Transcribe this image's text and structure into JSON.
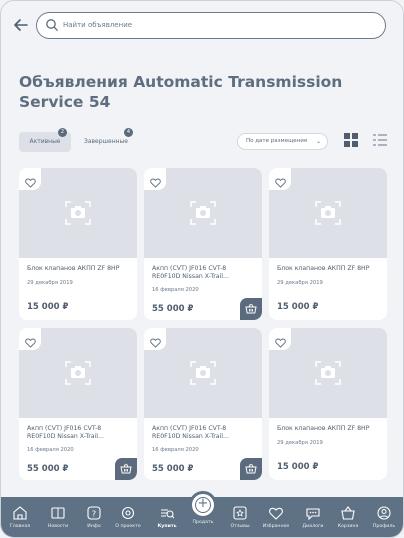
{
  "search": {
    "placeholder": "Найти объявление"
  },
  "page_title": "Объявления Automatic Transmission Service 54",
  "tabs": [
    {
      "label": "Активные",
      "count": "2"
    },
    {
      "label": "Завершенные",
      "count": "4"
    }
  ],
  "sort": {
    "selected": "По дате размещения"
  },
  "cards": [
    {
      "name": "Блок клапанов АКПП ZF 8HP",
      "date": "29 декабря 2019",
      "price": "15 000 ₽",
      "cart": false
    },
    {
      "name": "Акпп (CVT) JF016 CVT-8 RE0F10D Nissan X-Trail...",
      "date": "16 февраля 2020",
      "price": "55 000 ₽",
      "cart": true
    },
    {
      "name": "Блок клапанов АКПП ZF 8HP",
      "date": "29 декабря 2019",
      "price": "15 000 ₽",
      "cart": false
    },
    {
      "name": "Акпп (CVT) JF016 CVT-8 RE0F10D Nissan X-Trail...",
      "date": "16 февраля 2020",
      "price": "55 000 ₽",
      "cart": true
    },
    {
      "name": "Акпп (CVT) JF016 CVT-8 RE0F10D Nissan X-Trail...",
      "date": "16 февраля 2020",
      "price": "55 000 ₽",
      "cart": true
    },
    {
      "name": "Блок клапанов АКПП ZF 8HP",
      "date": "29 декабря 2019",
      "price": "15 000 ₽",
      "cart": false
    }
  ],
  "bottom_nav": [
    {
      "label": "Главная",
      "icon": "home-icon"
    },
    {
      "label": "Новости",
      "icon": "news-icon"
    },
    {
      "label": "Инфо",
      "icon": "info-icon"
    },
    {
      "label": "О проекте",
      "icon": "about-icon"
    },
    {
      "label": "Купить",
      "icon": "buy-icon",
      "active": true
    },
    {
      "label": "Продать",
      "icon": "plus-icon"
    },
    {
      "label": "Отзывы",
      "icon": "reviews-icon"
    },
    {
      "label": "Избранное",
      "icon": "heart-icon"
    },
    {
      "label": "Диалоги",
      "icon": "chat-icon"
    },
    {
      "label": "Корзина",
      "icon": "cart-icon"
    },
    {
      "label": "Профиль",
      "icon": "profile-icon"
    }
  ],
  "colors": {
    "accent": "#5f7185",
    "background": "#f1f3f6",
    "photo_placeholder": "#dde1e7"
  }
}
